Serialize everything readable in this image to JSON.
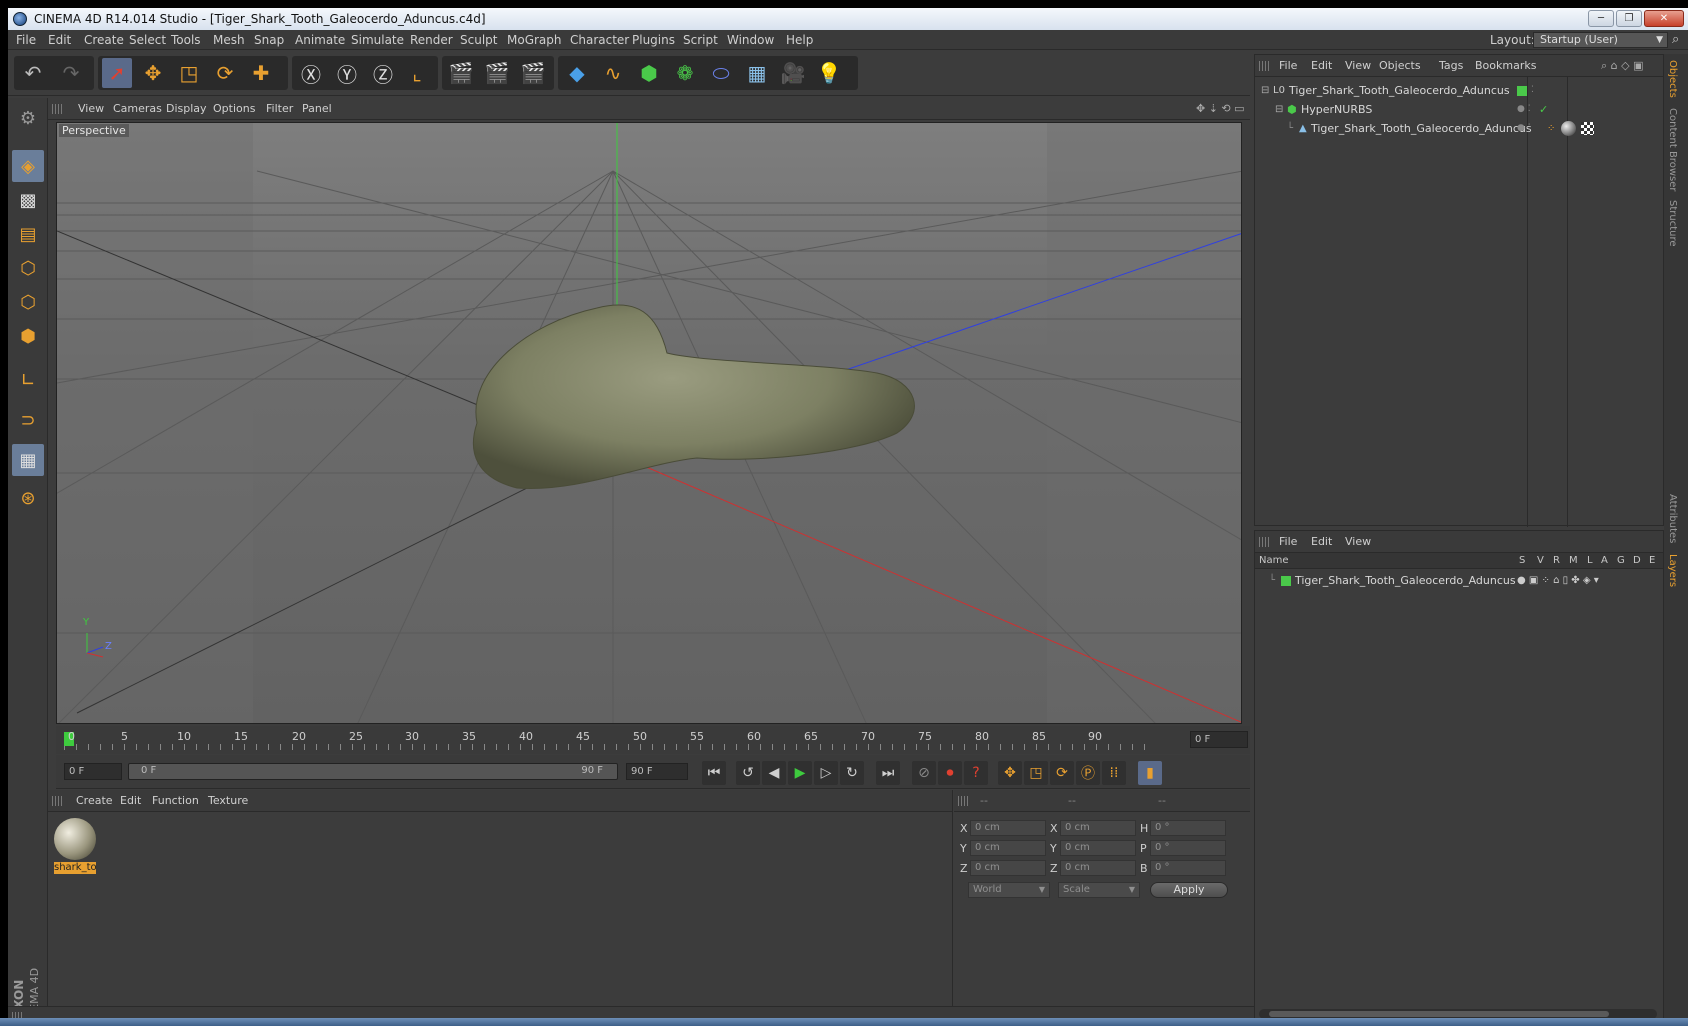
{
  "window": {
    "title": "CINEMA 4D R14.014 Studio - [Tiger_Shark_Tooth_Galeocerdo_Aduncus.c4d]",
    "btn_min": "─",
    "btn_max": "❐",
    "btn_close": "✕"
  },
  "menu": {
    "items": [
      "File",
      "Edit",
      "Create",
      "Select",
      "Tools",
      "Mesh",
      "Snap",
      "Animate",
      "Simulate",
      "Render",
      "Sculpt",
      "MoGraph",
      "Character",
      "Plugins",
      "Script",
      "Window",
      "Help"
    ],
    "layout_label": "Layout:",
    "layout_value": "Startup (User)"
  },
  "viewport": {
    "menu": [
      "View",
      "Cameras",
      "Display",
      "Options",
      "Filter",
      "Panel"
    ],
    "label": "Perspective",
    "axis_y": "Y",
    "axis_z": "Z"
  },
  "timeline": {
    "ticks": [
      "0",
      "5",
      "10",
      "15",
      "20",
      "25",
      "30",
      "35",
      "40",
      "45",
      "50",
      "55",
      "60",
      "65",
      "70",
      "75",
      "80",
      "85",
      "90"
    ],
    "current_frame": "0 F",
    "start_frame": "0 F",
    "range_start": "0 F",
    "range_end": "90 F",
    "end_frame": "90 F"
  },
  "material_manager": {
    "menu": [
      "Create",
      "Edit",
      "Function",
      "Texture"
    ],
    "material_name": "shark_to"
  },
  "coordinates": {
    "headers": [
      "--",
      "--",
      "--"
    ],
    "rows": [
      {
        "l1": "X",
        "v1": "0 cm",
        "l2": "X",
        "v2": "0 cm",
        "l3": "H",
        "v3": "0 °"
      },
      {
        "l1": "Y",
        "v1": "0 cm",
        "l2": "Y",
        "v2": "0 cm",
        "l3": "P",
        "v3": "0 °"
      },
      {
        "l1": "Z",
        "v1": "0 cm",
        "l2": "Z",
        "v2": "0 cm",
        "l3": "B",
        "v3": "0 °"
      }
    ],
    "mode": "World",
    "type": "Scale",
    "apply": "Apply"
  },
  "object_manager": {
    "menu": [
      "File",
      "Edit",
      "View",
      "Objects",
      "Tags",
      "Bookmarks"
    ],
    "objects": [
      {
        "name": "Tiger_Shark_Tooth_Galeocerdo_Aduncus"
      },
      {
        "name": "HyperNURBS"
      },
      {
        "name": "Tiger_Shark_Tooth_Galeocerdo_Aduncus"
      }
    ]
  },
  "layer_manager": {
    "menu": [
      "File",
      "Edit",
      "View"
    ],
    "col_name": "Name",
    "cols": [
      "S",
      "V",
      "R",
      "M",
      "L",
      "A",
      "G",
      "D",
      "E"
    ],
    "layers": [
      {
        "name": "Tiger_Shark_Tooth_Galeocerdo_Aduncus"
      }
    ]
  },
  "side_tabs": [
    "Objects",
    "Content Browser",
    "Structure",
    "Attributes",
    "Layers"
  ],
  "brand": {
    "line1": "MAXON",
    "line2": "CINEMA 4D"
  },
  "colors": {
    "accent": "#e8a030",
    "selection": "#6a7e9a",
    "layer_green": "#4ac94a"
  }
}
